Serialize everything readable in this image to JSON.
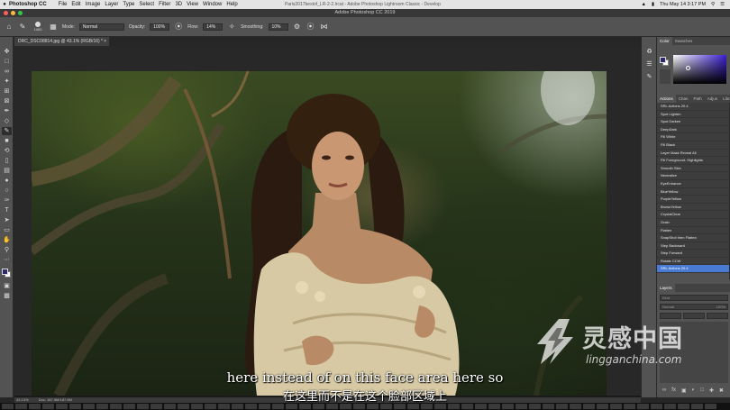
{
  "menubar": {
    "app_name": "Photoshop CC",
    "items": [
      "File",
      "Edit",
      "Image",
      "Layer",
      "Type",
      "Select",
      "Filter",
      "3D",
      "View",
      "Window",
      "Help"
    ],
    "background_window_title": "Paris2017bestof_LR-2-2.lrcat - Adobe Photoshop Lightroom Classic - Develop",
    "clock": "Thu May 14  3:17 PM"
  },
  "window": {
    "title": "Adobe Photoshop CC 2019"
  },
  "options_bar": {
    "brush_size": "1400",
    "mode_label": "Mode:",
    "mode_value": "Normal",
    "opacity_label": "Opacity:",
    "opacity_value": "100%",
    "flow_label": "Flow:",
    "flow_value": "14%",
    "smoothing_label": "Smoothing:",
    "smoothing_value": "10%"
  },
  "document": {
    "tab_title": "DRC_DSC08814.jpg @ 43.1% (RGB/16) *",
    "status_zoom": "43.13%",
    "status_doc": "Doc: 187.9M/187.9M"
  },
  "color_panel": {
    "tabs": [
      "Color",
      "Swatches"
    ],
    "foreground": "#2d2a6b",
    "background": "#ffffff"
  },
  "actions_panel": {
    "tabs": [
      "Actions",
      "Chan",
      "Path",
      "Adjus",
      "Librar"
    ],
    "items": [
      "SRL Actions 20.4",
      "Spot Lighten",
      "Spot Darken",
      "DeepDark",
      "Fill White",
      "Fill Black",
      "Layer Mask Reveal All",
      "Fill Foreground- Highlights",
      "Smooth Skin",
      "Neutralize",
      "EyeEnhance",
      "BlueYellow",
      "PurpleYellow",
      "BrownYellow",
      "CrystalClear",
      "Grain",
      "Flatten",
      "SnapShot then Flatten",
      "Step Backward",
      "Step Forward",
      "Rotate CCW",
      "SRL Actions 20.4"
    ],
    "selected_index": 21
  },
  "layers_panel": {
    "title": "Layers",
    "filter_placeholder": "Kind",
    "blend_mode": "Normal",
    "opacity": "100%"
  },
  "subtitles": {
    "english": "here instead of on this face area here so",
    "chinese": "在这里而不是在这个脸部区域上"
  },
  "watermark": {
    "brand_cn": "灵感中国",
    "url": "lingganchina.com"
  }
}
